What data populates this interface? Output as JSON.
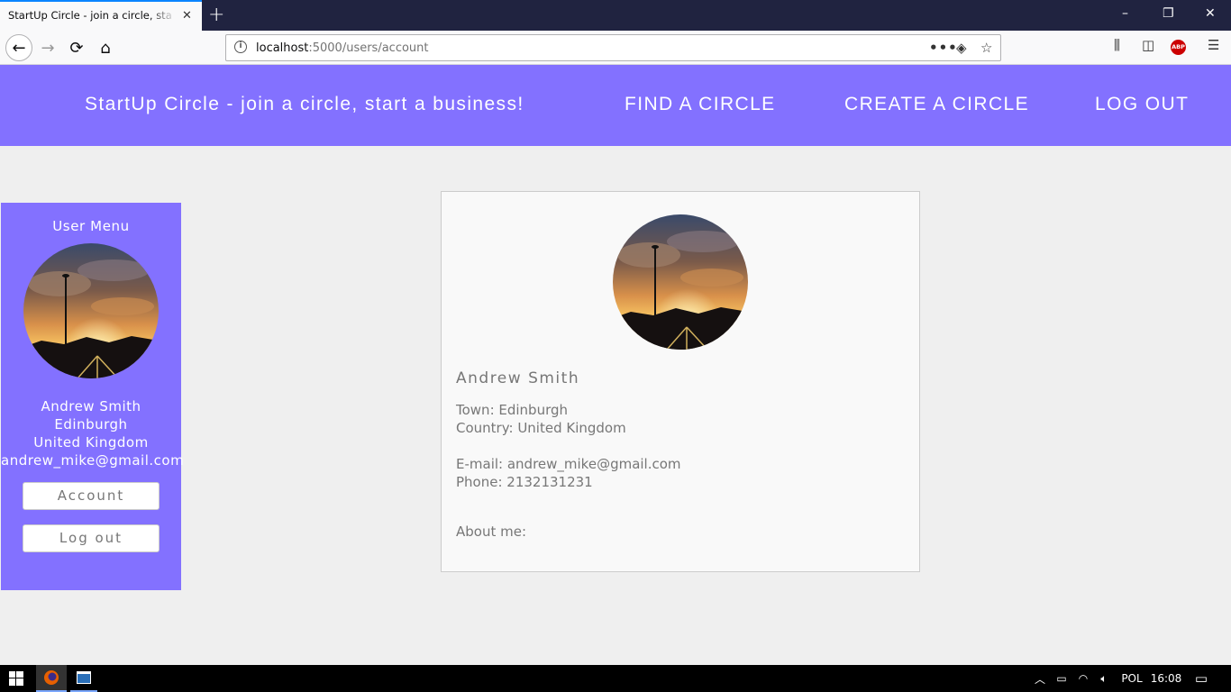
{
  "browser": {
    "tab_title": "StartUp Circle - join a circle, start a business!",
    "tab_close": "✕",
    "new_tab": "+",
    "url_host": "localhost",
    "url_rest": ":5000/users/account",
    "window_controls": {
      "minimize": "–",
      "maximize": "❐",
      "close": "✕"
    }
  },
  "site": {
    "brand": "StartUp Circle - join a circle, start a business!",
    "nav": [
      "FIND A CIRCLE",
      "CREATE A CIRCLE",
      "LOG OUT"
    ],
    "accent_color": "#8371ff"
  },
  "sidebar": {
    "title": "User Menu",
    "name": "Andrew Smith",
    "town": "Edinburgh",
    "country": "United Kingdom",
    "email": "andrew_mike@gmail.com",
    "account_button": "Account",
    "logout_button": "Log out"
  },
  "profile": {
    "name": "Andrew Smith",
    "town": "Town: Edinburgh",
    "country": "Country: United Kingdom",
    "email": "E-mail: andrew_mike@gmail.com",
    "phone": "Phone: 2132131231",
    "about": "About me:"
  },
  "taskbar": {
    "language": "POL",
    "time": "16:08"
  }
}
